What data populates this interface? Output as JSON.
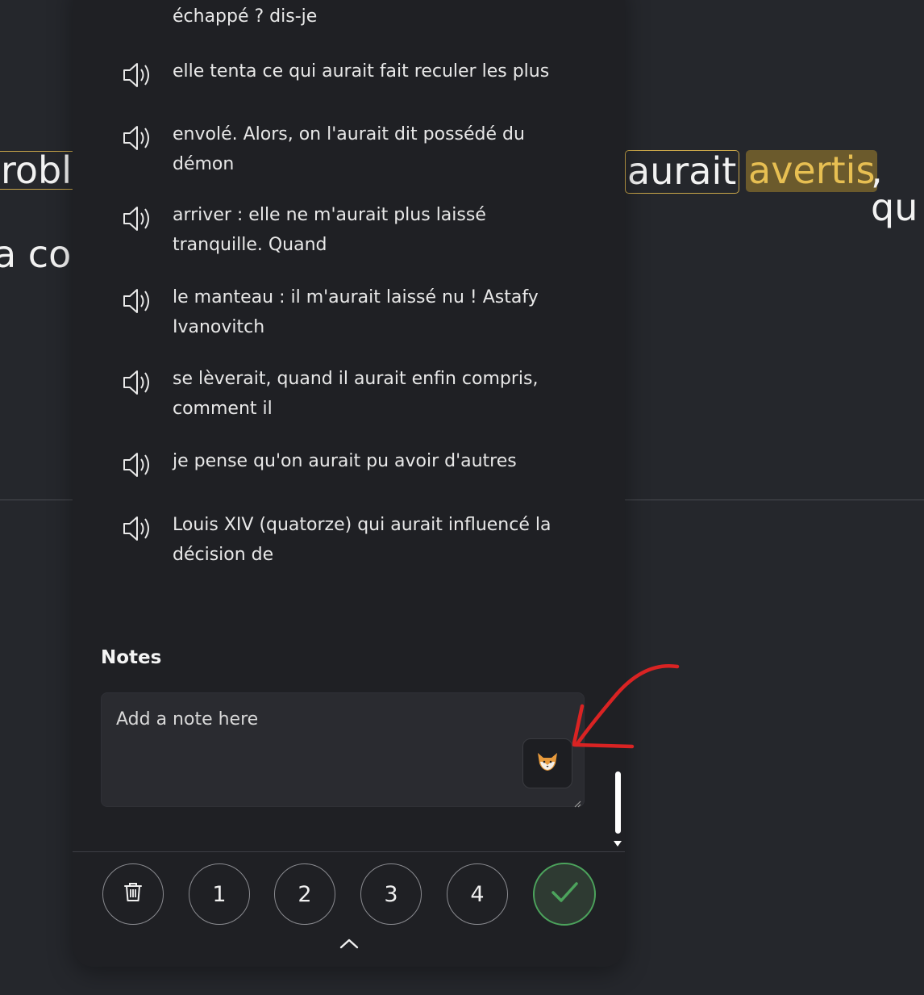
{
  "background_text": {
    "fragment_left_top": "robl",
    "fragment_left_bottom": "a col",
    "word_aurait": "aurait",
    "word_avertis": "avertis",
    "trailing": ", qu"
  },
  "sentences": [
    {
      "text": "échappé ? dis-je",
      "speaker_icon": "speaker-icon"
    },
    {
      "text": "elle tenta ce qui aurait fait reculer les plus",
      "speaker_icon": "speaker-icon"
    },
    {
      "text": "envolé. Alors, on l'aurait dit possédé du démon",
      "speaker_icon": "speaker-icon"
    },
    {
      "text": "arriver : elle ne m'aurait plus laissé tranquille. Quand",
      "speaker_icon": "speaker-icon"
    },
    {
      "text": "le manteau : il m'aurait laissé nu ! Astafy Ivanovitch",
      "speaker_icon": "speaker-icon"
    },
    {
      "text": "se lèverait, quand il aurait enfin compris, comment il",
      "speaker_icon": "speaker-icon"
    },
    {
      "text": "je pense qu'on aurait pu avoir d'autres",
      "speaker_icon": "speaker-icon"
    },
    {
      "text": "Louis XIV (quatorze) qui aurait influencé la décision de",
      "speaker_icon": "speaker-icon"
    }
  ],
  "notes": {
    "label": "Notes",
    "placeholder": "Add a note here",
    "value": "",
    "assistant_icon": "fox-icon"
  },
  "toolbar": {
    "delete_icon": "trash-icon",
    "ratings": [
      "1",
      "2",
      "3",
      "4"
    ],
    "done_icon": "checkmark-icon",
    "expand_icon": "chevron-up-icon"
  },
  "colors": {
    "page_background": "#25272c",
    "panel_background": "#1f2024",
    "highlight_gold": "#e7bf52",
    "done_green": "#4ca35c",
    "annotation_red": "#d92323"
  }
}
